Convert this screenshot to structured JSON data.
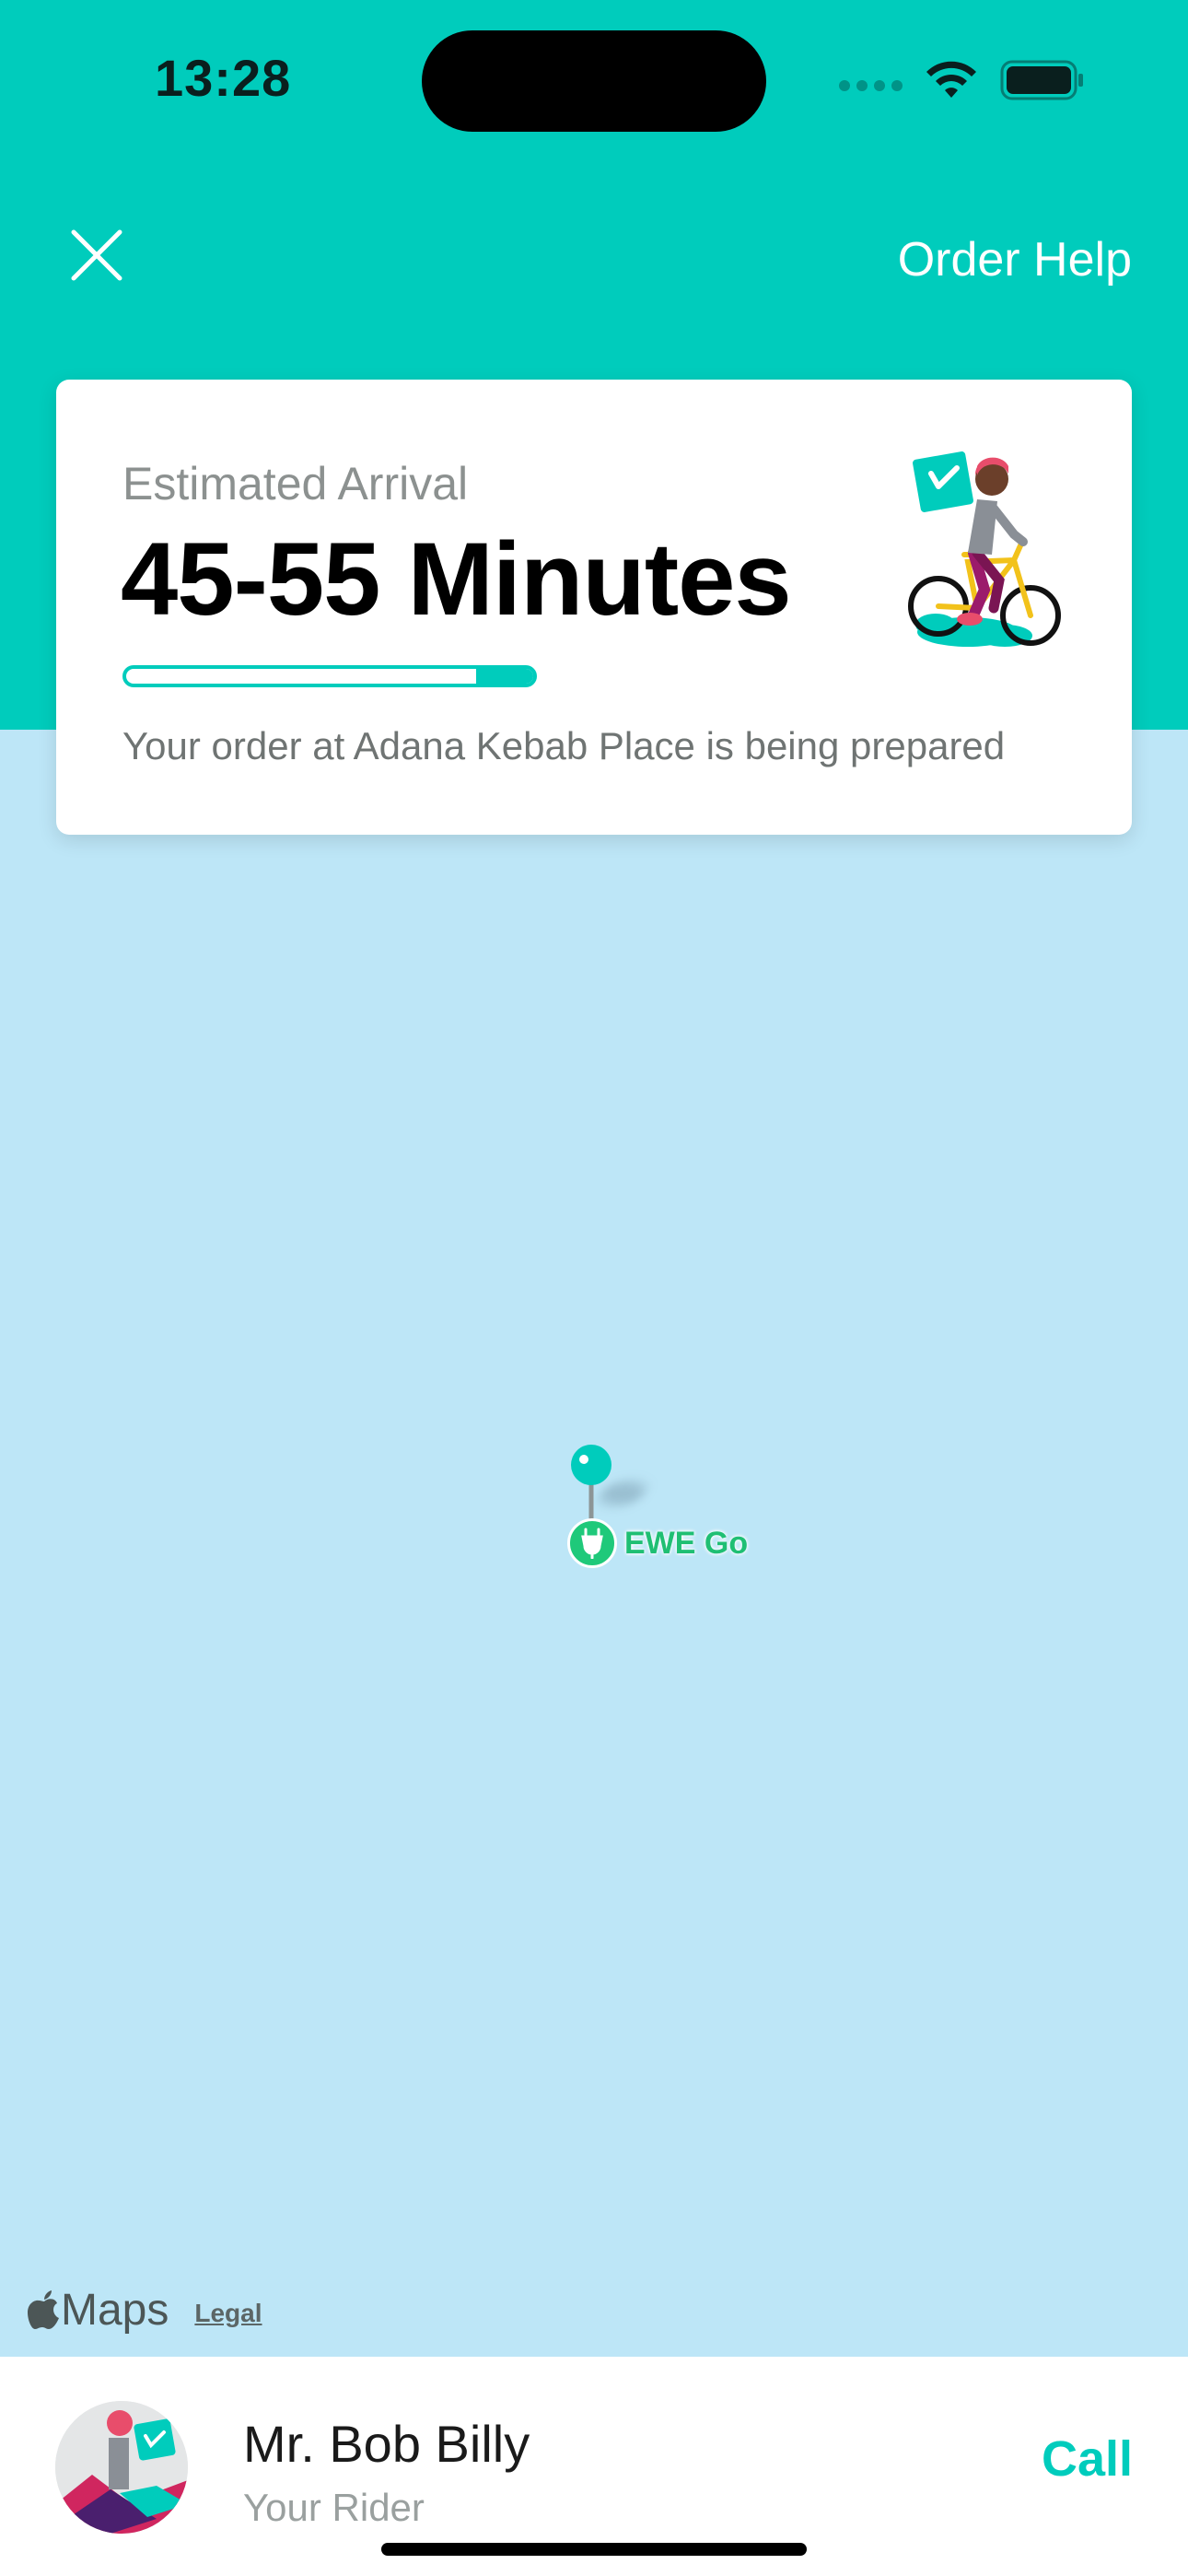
{
  "status_bar": {
    "time": "13:28"
  },
  "top_bar": {
    "close_icon": "close-icon",
    "order_help_label": "Order Help"
  },
  "eta_card": {
    "label": "Estimated Arrival",
    "value": "45-55 Minutes",
    "progress_fill_fraction": 0.14,
    "status_text": "Your order at Adana Kebab Place is being prepared"
  },
  "map": {
    "poi_label": "EWE Go",
    "maps_label": "Maps",
    "legal_label": "Legal"
  },
  "rider": {
    "name": "Mr. Bob Billy",
    "role": "Your Rider",
    "call_label": "Call"
  },
  "colors": {
    "brand_teal": "#00ccbc",
    "map_water": "#bde6f7",
    "poi_green": "#1fc97a"
  }
}
